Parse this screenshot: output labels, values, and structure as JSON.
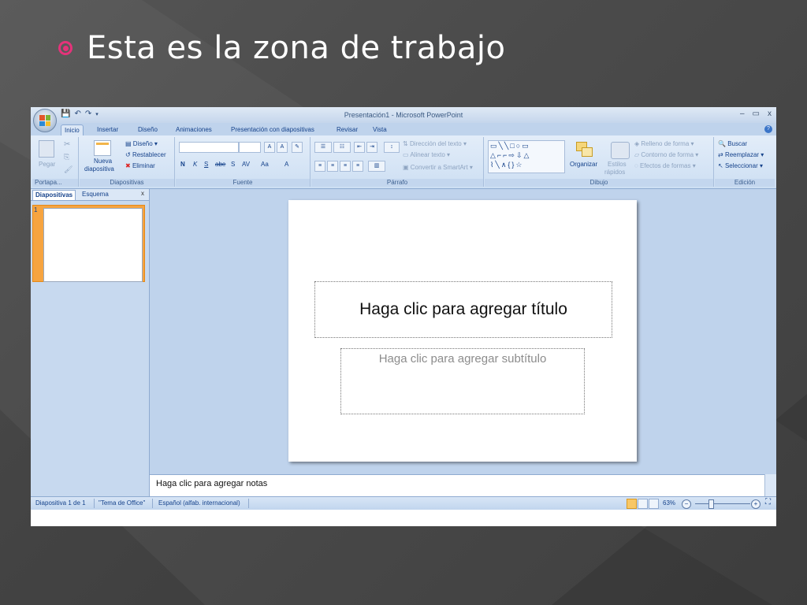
{
  "slide": {
    "heading": "Esta es la zona de trabajo"
  },
  "window": {
    "title": "Presentación1 - Microsoft PowerPoint",
    "minimize": "–",
    "maximize": "▭",
    "close": "x"
  },
  "tabs": [
    "Inicio",
    "Insertar",
    "Diseño",
    "Animaciones",
    "Presentación con diapositivas",
    "Revisar",
    "Vista"
  ],
  "ribbon": {
    "portapapeles": {
      "paste": "Pegar",
      "label": "Portapa..."
    },
    "diapositivas": {
      "new_slide_line1": "Nueva",
      "new_slide_line2": "diapositiva",
      "layout": "Diseño",
      "reset": "Restablecer",
      "delete": "Eliminar",
      "label": "Diapositivas"
    },
    "fuente": {
      "label": "Fuente",
      "bold": "N",
      "italic": "K",
      "underline": "S",
      "strike": "abe",
      "shadow": "S",
      "spacing": "AV",
      "case": "Aa",
      "color": "A",
      "grow": "A",
      "shrink": "A"
    },
    "parrafo": {
      "direction": "Dirección del texto",
      "align": "Alinear texto",
      "smartart": "Convertir a SmartArt",
      "label": "Párrafo"
    },
    "dibujo": {
      "arrange": "Organizar",
      "styles_line1": "Estilos",
      "styles_line2": "rápidos",
      "fill": "Relleno de forma",
      "outline": "Contorno de forma",
      "effects": "Efectos de formas",
      "label": "Dibujo"
    },
    "edicion": {
      "find": "Buscar",
      "replace": "Reemplazar",
      "select": "Seleccionar",
      "label": "Edición"
    }
  },
  "panel": {
    "tab_slides": "Diapositivas",
    "tab_outline": "Esquema",
    "close": "x",
    "slide_number": "1"
  },
  "editor": {
    "title_placeholder": "Haga clic para agregar título",
    "subtitle_placeholder": "Haga clic para agregar subtítulo",
    "notes_placeholder": "Haga clic para agregar notas"
  },
  "status": {
    "slide_pos": "Diapositiva 1 de 1",
    "theme": "\"Tema de Office\"",
    "language": "Español (alfab. internacional)",
    "zoom": "63%"
  }
}
